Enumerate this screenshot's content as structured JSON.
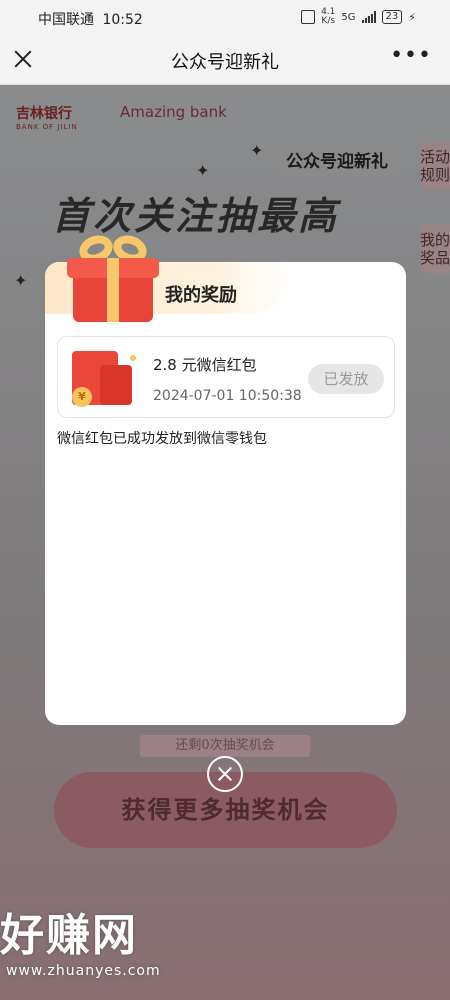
{
  "status_bar": {
    "carrier": "中国联通",
    "time": "10:52",
    "net_speed_value": "4.1",
    "net_speed_unit": "K/s",
    "network": "5G",
    "battery": "23"
  },
  "nav": {
    "title": "公众号迎新礼",
    "more_label": "•••"
  },
  "background_page": {
    "bank_name": "吉林银行",
    "bank_name_en": "BANK OF JILIN",
    "bank_slogan": "Amazing bank",
    "event_pill": "公众号迎新礼",
    "headline": "首次关注抽最高",
    "side_tab_rules": "活动规则",
    "side_tab_prizes": "我的奖品",
    "remaining_chances": "还剩0次抽奖机会",
    "more_chances_button": "获得更多抽奖机会"
  },
  "modal": {
    "title": "我的奖励",
    "reward": {
      "name": "2.8 元微信红包",
      "time": "2024-07-01 10:50:38",
      "status": "已发放",
      "coin_symbol": "¥"
    },
    "notice": "微信红包已成功发放到微信零钱包"
  },
  "watermark": {
    "text": "好赚网",
    "url": "www.zhuanyes.com"
  }
}
